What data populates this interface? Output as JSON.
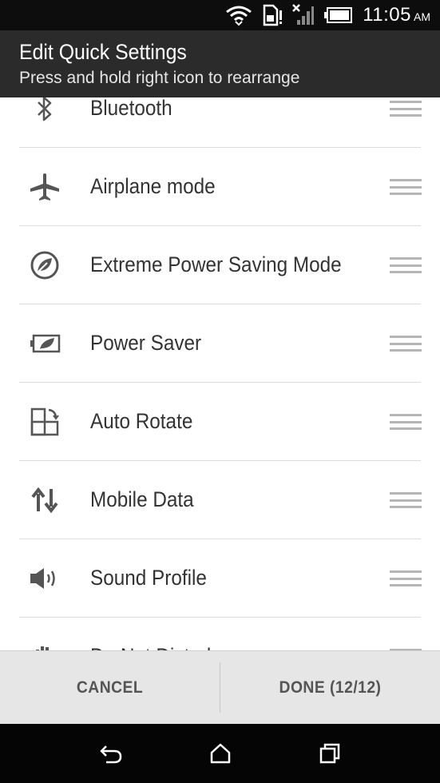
{
  "status_bar": {
    "time": "11:05",
    "ampm": "AM",
    "icons": [
      "wifi-icon",
      "sim-alert-icon",
      "signal-icon",
      "battery-icon"
    ]
  },
  "header": {
    "title": "Edit Quick Settings",
    "subtitle": "Press and hold right icon to rearrange"
  },
  "items": [
    {
      "label": "Bluetooth",
      "icon": "bluetooth-icon"
    },
    {
      "label": "Airplane mode",
      "icon": "airplane-icon"
    },
    {
      "label": "Extreme Power Saving Mode",
      "icon": "leaf-icon"
    },
    {
      "label": "Power Saver",
      "icon": "battery-leaf-icon"
    },
    {
      "label": "Auto Rotate",
      "icon": "rotate-icon"
    },
    {
      "label": "Mobile Data",
      "icon": "data-arrows-icon"
    },
    {
      "label": "Sound Profile",
      "icon": "speaker-icon"
    },
    {
      "label": "Do Not Disturb",
      "icon": "hand-icon"
    }
  ],
  "buttons": {
    "cancel": "CANCEL",
    "done": "DONE  (12/12)"
  },
  "nav": {
    "icons": [
      "back-icon",
      "home-icon",
      "recents-icon"
    ]
  }
}
